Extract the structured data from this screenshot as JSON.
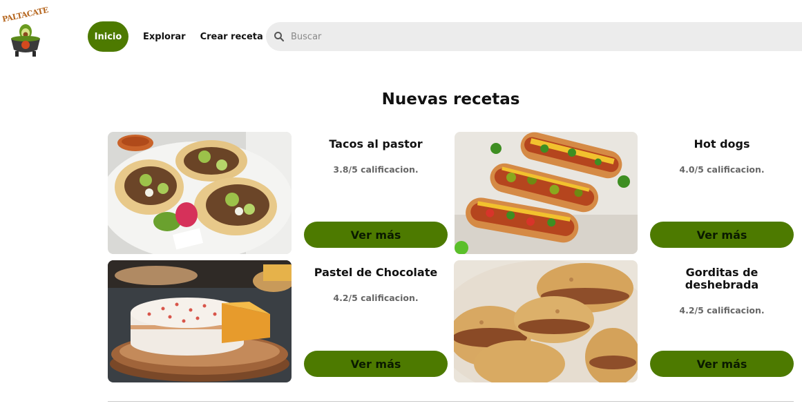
{
  "header": {
    "logo_text": "PALTACATE",
    "nav": [
      {
        "label": "Inicio",
        "active": true
      },
      {
        "label": "Explorar",
        "active": false
      },
      {
        "label": "Crear receta",
        "active": false
      }
    ],
    "search": {
      "placeholder": "Buscar",
      "value": ""
    }
  },
  "main": {
    "section_title": "Nuevas recetas",
    "recipes": [
      {
        "title": "Tacos al pastor",
        "rating": "3.8/5 calificacion.",
        "button": "Ver más",
        "image": "tacos-photo"
      },
      {
        "title": "Hot dogs",
        "rating": "4.0/5 calificacion.",
        "button": "Ver más",
        "image": "hot-dogs-photo"
      },
      {
        "title": "Pastel de Chocolate",
        "rating": "4.2/5 calificacion.",
        "button": "Ver más",
        "image": "cake-photo"
      },
      {
        "title": "Gorditas de deshebrada",
        "rating": "4.2/5 calificacion.",
        "button": "Ver más",
        "image": "gorditas-photo"
      }
    ]
  },
  "colors": {
    "accent": "#4d7a00",
    "search_bg": "#ececec",
    "rating_text": "#666666",
    "divider": "#c8c8c8"
  }
}
